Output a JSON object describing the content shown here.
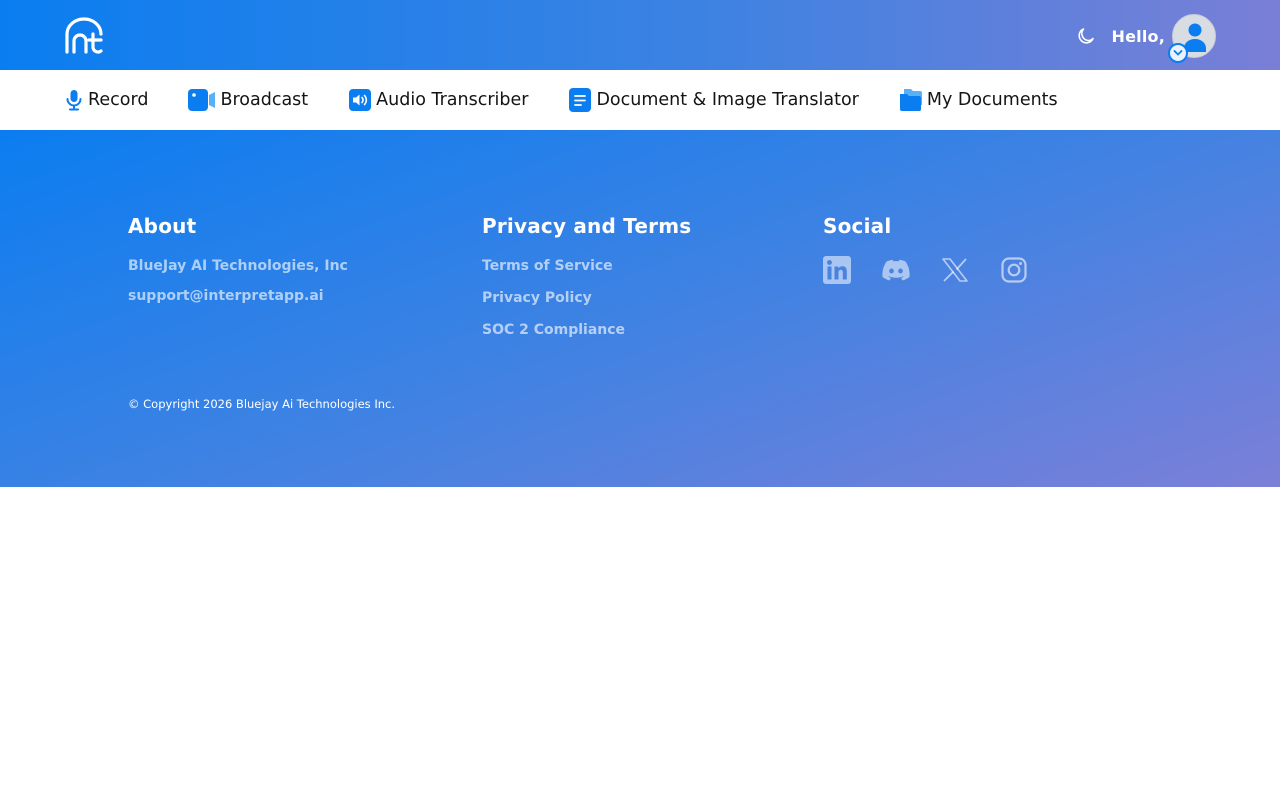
{
  "header": {
    "greeting": "Hello,",
    "logo_icon": "int-logo-icon",
    "theme_icon": "moon-icon",
    "avatar_icon": "user-avatar-icon"
  },
  "nav": {
    "items": [
      {
        "label": "Record",
        "icon": "microphone-icon"
      },
      {
        "label": "Broadcast",
        "icon": "video-camera-icon"
      },
      {
        "label": "Audio Transcriber",
        "icon": "speaker-icon"
      },
      {
        "label": "Document & Image Translator",
        "icon": "document-icon"
      },
      {
        "label": "My Documents",
        "icon": "folder-icon"
      }
    ]
  },
  "footer": {
    "about": {
      "title": "About",
      "company": "BlueJay AI Technologies, Inc",
      "email": "support@interpretapp.ai"
    },
    "privacy": {
      "title": "Privacy and Terms",
      "links": [
        "Terms of Service",
        "Privacy Policy",
        "SOC 2 Compliance"
      ]
    },
    "social": {
      "title": "Social",
      "icons": [
        "linkedin-icon",
        "discord-icon",
        "x-icon",
        "instagram-icon"
      ]
    },
    "copyright": "© Copyright 2026 Bluejay Ai Technologies Inc."
  },
  "colors": {
    "brand": "#0a7ef0",
    "gradient_end": "#7a7fd6"
  }
}
